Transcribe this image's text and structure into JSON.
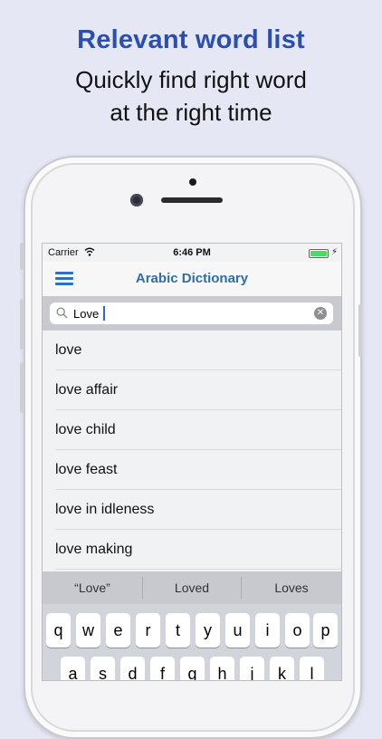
{
  "promo": {
    "title": "Relevant word list",
    "subtitle_line1": "Quickly find right word",
    "subtitle_line2": "at the right time"
  },
  "status_bar": {
    "carrier": "Carrier",
    "time": "6:46 PM"
  },
  "nav": {
    "title": "Arabic Dictionary"
  },
  "search": {
    "value": "Love"
  },
  "words": [
    "love",
    "love affair",
    "love child",
    "love feast",
    "love in idleness",
    "love making"
  ],
  "suggestions": [
    "“Love”",
    "Loved",
    "Loves"
  ],
  "keyboard": {
    "row1": [
      "q",
      "w",
      "e",
      "r",
      "t",
      "y",
      "u",
      "i",
      "o",
      "p"
    ],
    "row2": [
      "a",
      "s",
      "d",
      "f",
      "g",
      "h",
      "j",
      "k",
      "l"
    ]
  },
  "colors": {
    "accent": "#2c6fc2",
    "promo_title": "#2a4fb0",
    "battery": "#4cd964"
  }
}
